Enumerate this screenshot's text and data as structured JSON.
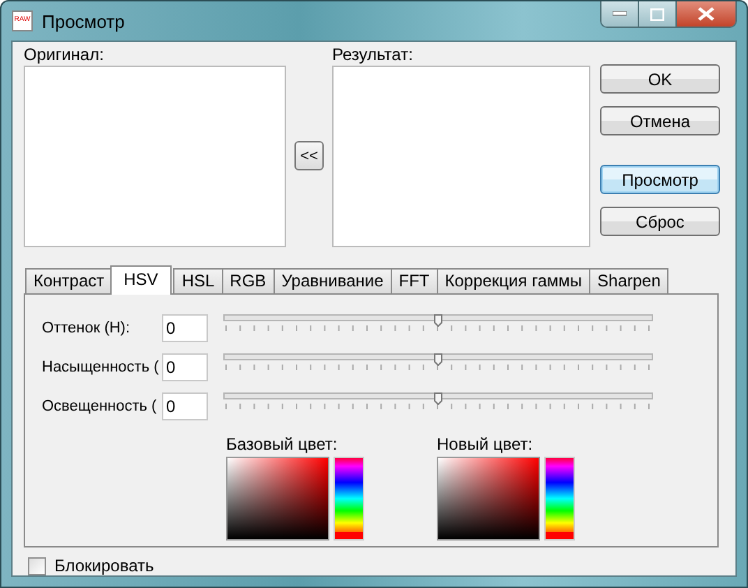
{
  "window": {
    "title": "Просмотр",
    "app_icon_text": "RAW"
  },
  "original_label": "Оригинал:",
  "result_label": "Результат:",
  "copy_button": "<<",
  "buttons": [
    {
      "label": "OK",
      "focused": false
    },
    {
      "label": "Отмена",
      "focused": false
    },
    {
      "label": "Просмотр",
      "focused": true
    },
    {
      "label": "Сброс",
      "focused": false
    }
  ],
  "tabs": [
    {
      "label": "Контраст",
      "selected": false
    },
    {
      "label": "HSV",
      "selected": true
    },
    {
      "label": "HSL",
      "selected": false
    },
    {
      "label": "RGB",
      "selected": false
    },
    {
      "label": "Уравнивание",
      "selected": false
    },
    {
      "label": "FFT",
      "selected": false
    },
    {
      "label": "Коррекция гаммы",
      "selected": false
    },
    {
      "label": "Sharpen",
      "selected": false
    }
  ],
  "sliders": [
    {
      "label": "Оттенок (H):",
      "value": "0",
      "level": 0.5
    },
    {
      "label": "Насыщенность (",
      "value": "0",
      "level": 0.5
    },
    {
      "label": "Освещенность (",
      "value": "0",
      "level": 0.5
    }
  ],
  "colors": [
    {
      "label": "Базовый цвет:"
    },
    {
      "label": "Новый цвет:"
    }
  ],
  "lock": {
    "label": "Блокировать",
    "checked": false
  }
}
